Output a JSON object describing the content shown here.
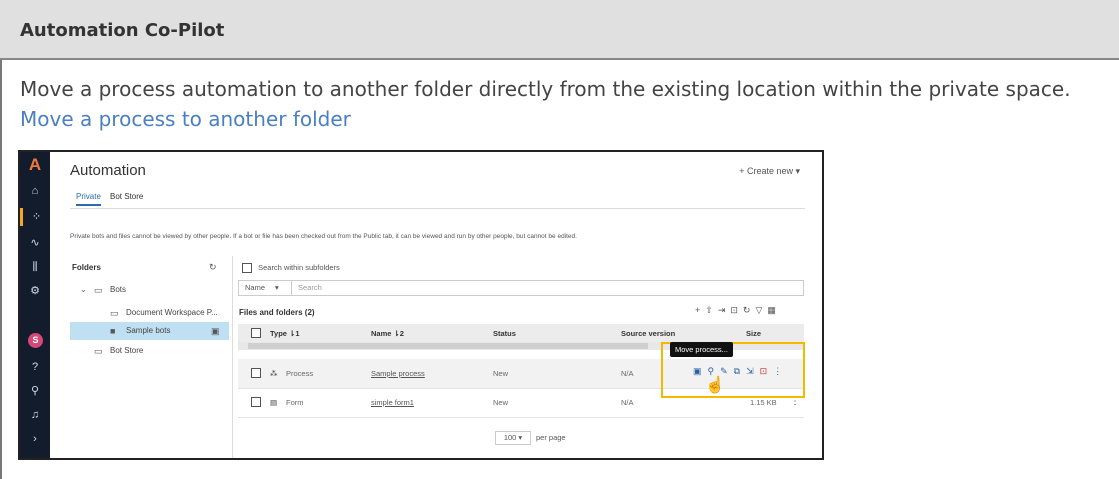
{
  "header": {
    "title": "Automation Co-Pilot"
  },
  "intro": {
    "text": "Move a process automation to another folder directly from the existing location within the private space.",
    "link": "Move a process to another folder"
  },
  "app": {
    "title": "Automation",
    "create_new": "+ Create new ▾",
    "tabs": [
      "Private",
      "Bot Store"
    ],
    "notice": "Private bots and files cannot be viewed by other people. If a bot or file has been checked out from the Public tab, it can be viewed and run by other people, but cannot be edited.",
    "folders": {
      "heading": "Folders",
      "items": [
        {
          "label": "Bots"
        },
        {
          "label": "Document Workspace P..."
        },
        {
          "label": "Sample bots"
        },
        {
          "label": "Bot Store"
        }
      ]
    },
    "search": {
      "subfolders_label": "Search within subfolders",
      "field": "Name",
      "placeholder": "Search"
    },
    "files": {
      "heading": "Files and folders (2)",
      "columns": [
        "Type ⇂1",
        "Name ⇂2",
        "Status",
        "Source version",
        "Size"
      ],
      "rows": [
        {
          "type": "Process",
          "name": "Sample process",
          "status": "New",
          "source_version": "N/A",
          "size": ""
        },
        {
          "type": "Form",
          "name": "simple form1",
          "status": "New",
          "source_version": "N/A",
          "size": "1.15 KB"
        }
      ]
    },
    "tooltip": "Move process...",
    "pagination": {
      "page_size": "100 ▾",
      "label": "per page"
    },
    "icons": {
      "nav": [
        "home-icon",
        "bots-icon",
        "activity-icon",
        "manage-icon",
        "admin-icon",
        "user-avatar",
        "help-icon",
        "pilot-icon",
        "notification-icon",
        "expand-icon"
      ],
      "toolbar": [
        "add-icon",
        "upload-icon",
        "export-icon",
        "delete-icon",
        "refresh-icon",
        "filter-icon",
        "columns-icon"
      ],
      "row_actions": [
        "move-icon",
        "view-icon",
        "edit-icon",
        "copy-icon",
        "checkout-icon",
        "delete-icon",
        "more-icon"
      ]
    },
    "avatar_initial": "S",
    "colors": {
      "highlight_box": "#f5b800",
      "selected_folder": "#bfe0f2",
      "nav_bg": "#121c2c"
    }
  }
}
